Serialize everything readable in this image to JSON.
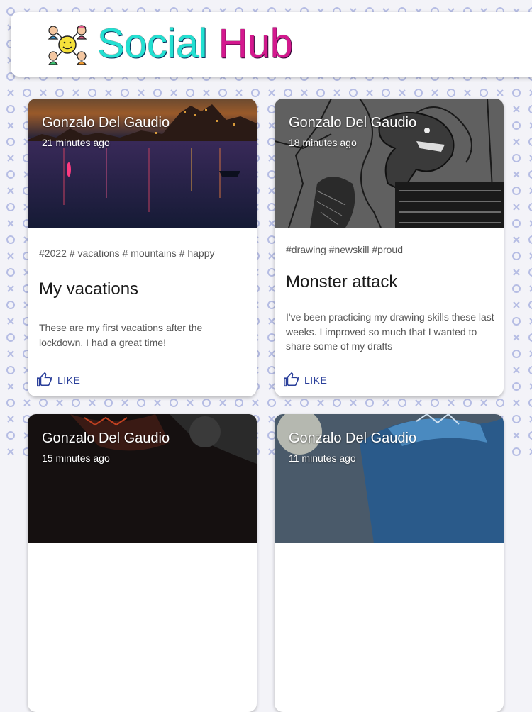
{
  "header": {
    "title_part1": "Social ",
    "title_part2": "Hub",
    "logo_icon": "friends-group-icon"
  },
  "posts": [
    {
      "author": "Gonzalo Del Gaudio",
      "time": "21 minutes ago",
      "tags": "#2022 # vacations # mountains # happy",
      "title": "My vacations",
      "body": "These are my first vacations after the lockdown. I had a great time!",
      "like_label": "LIKE",
      "image": "night-harbor-photo"
    },
    {
      "author": "Gonzalo Del Gaudio",
      "time": "18 minutes ago",
      "tags": "#drawing #newskill #proud",
      "title": "Monster attack",
      "body": "I've been practicing my drawing skills these last weeks. I improved so much that I wanted to share some of my drafts",
      "like_label": "LIKE",
      "image": "monster-drawing"
    },
    {
      "author": "Gonzalo Del Gaudio",
      "time": "15 minutes ago",
      "image": "dark-creature-photo"
    },
    {
      "author": "Gonzalo Del Gaudio",
      "time": "11 minutes ago",
      "image": "moon-dragon-photo"
    }
  ],
  "colors": {
    "like": "#2a3f9a",
    "pattern": "#b6bde4",
    "title_cyan": "#23e0d2",
    "title_magenta": "#d4188e"
  }
}
